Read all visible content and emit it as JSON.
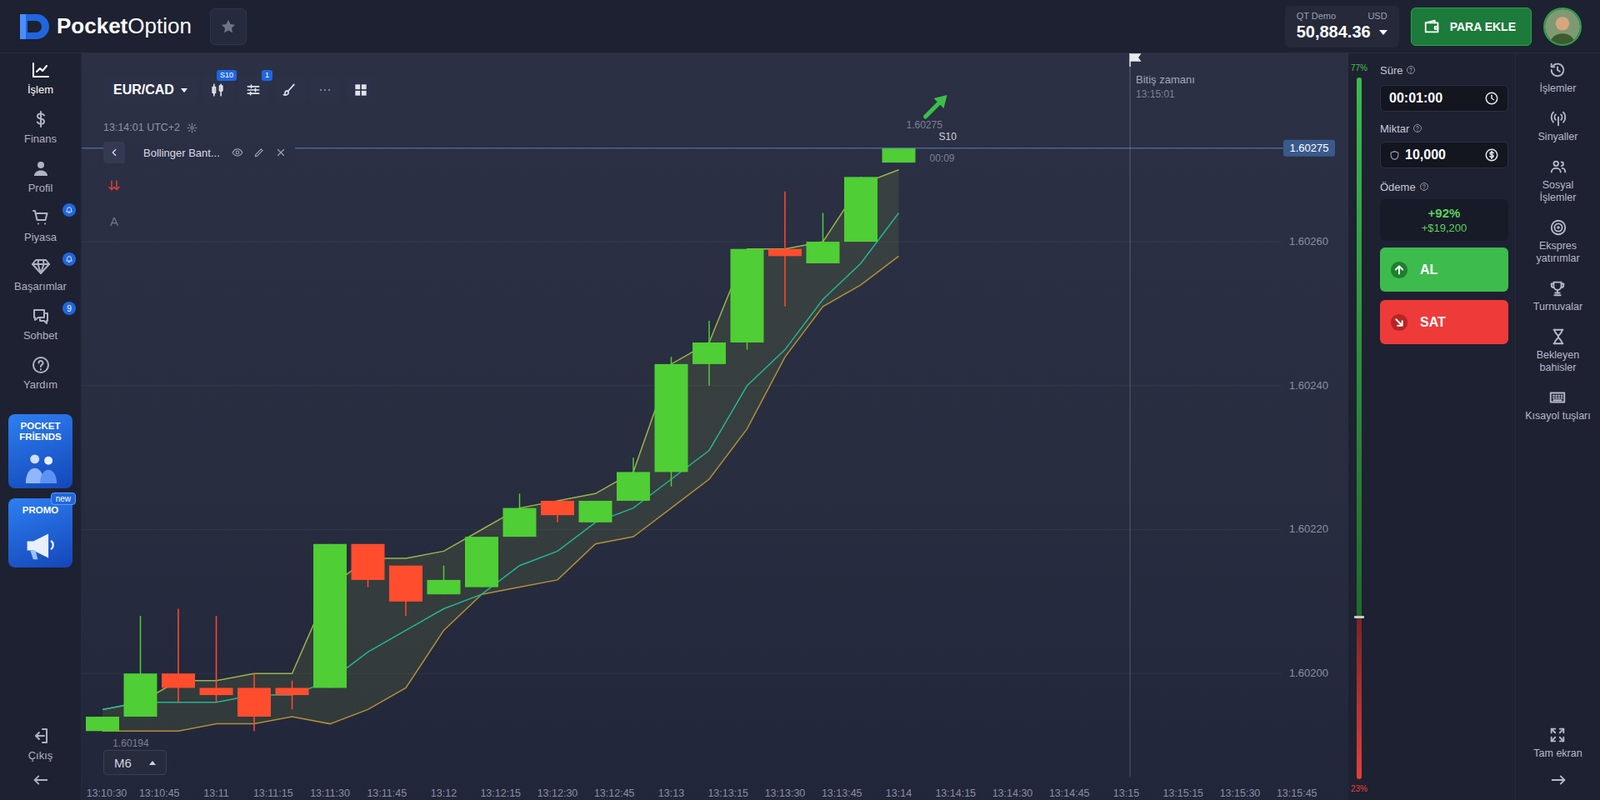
{
  "topbar": {
    "logo": {
      "bold": "Pocket",
      "light": "Option"
    },
    "account": {
      "mode": "QT Demo",
      "currency": "USD",
      "balance": "50,884.36"
    },
    "deposit_button": "PARA EKLE"
  },
  "sidebar": {
    "items": [
      {
        "label": "İşlem",
        "selected": true,
        "kind": "plain"
      },
      {
        "label": "Finans",
        "selected": false,
        "kind": "plain"
      },
      {
        "label": "Profil",
        "selected": false,
        "kind": "plain"
      },
      {
        "label": "Piyasa",
        "selected": false,
        "kind": "bell"
      },
      {
        "label": "Başarımlar",
        "selected": false,
        "kind": "bell"
      },
      {
        "label": "Sohbet",
        "selected": false,
        "kind": "count",
        "badge": "9"
      },
      {
        "label": "Yardım",
        "selected": false,
        "kind": "plain"
      }
    ],
    "promos": [
      {
        "title": "POCKET FRİENDS",
        "kind": "friends"
      },
      {
        "title": "PROMO",
        "kind": "promo",
        "badge": "new"
      }
    ],
    "logout": "Çıkış"
  },
  "chart": {
    "pair": "EUR/CAD",
    "chart_type_badge": "S10",
    "settings_badge": "1",
    "clock": "13:14:01 UTC+2",
    "indicator": "Bollinger Bant...",
    "text_tool": "A",
    "timeframe": "M6",
    "price_ticks": [
      "1.60260",
      "1.60240",
      "1.60220",
      "1.60200"
    ],
    "time_ticks": [
      "13:10:30",
      "13:10:45",
      "13:11",
      "13:11:15",
      "13:11:30",
      "13:11:45",
      "13:12",
      "13:12:15",
      "13:12:30",
      "13:12:45",
      "13:13",
      "13:13:15",
      "13:13:30",
      "13:13:45",
      "13:14",
      "13:14:15",
      "13:14:30",
      "13:14:45",
      "13:15",
      "13:15:15",
      "13:15:30",
      "13:15:45"
    ],
    "current_price": "1.60275",
    "candle_price_label": "1.60275",
    "candle_timer": {
      "period": "S10",
      "remaining": "00:09"
    },
    "low_label": "1.60194",
    "expiry": {
      "label": "Bitiş zamanı",
      "time": "13:15:01"
    },
    "candles": [
      {
        "open": 1.60192,
        "high": 1.60194,
        "low": 1.60192,
        "close": 1.60194
      },
      {
        "open": 1.60194,
        "high": 1.60208,
        "low": 1.60194,
        "close": 1.602
      },
      {
        "open": 1.602,
        "high": 1.60209,
        "low": 1.60196,
        "close": 1.60198
      },
      {
        "open": 1.60198,
        "high": 1.60208,
        "low": 1.60196,
        "close": 1.60197
      },
      {
        "open": 1.60198,
        "high": 1.602,
        "low": 1.60192,
        "close": 1.60194
      },
      {
        "open": 1.60198,
        "high": 1.60199,
        "low": 1.60195,
        "close": 1.60197
      },
      {
        "open": 1.60198,
        "high": 1.60218,
        "low": 1.60198,
        "close": 1.60218
      },
      {
        "open": 1.60218,
        "high": 1.60218,
        "low": 1.60212,
        "close": 1.60213
      },
      {
        "open": 1.60215,
        "high": 1.60215,
        "low": 1.60208,
        "close": 1.6021
      },
      {
        "open": 1.60211,
        "high": 1.60215,
        "low": 1.60211,
        "close": 1.60213
      },
      {
        "open": 1.60212,
        "high": 1.60219,
        "low": 1.60212,
        "close": 1.60219
      },
      {
        "open": 1.60219,
        "high": 1.60225,
        "low": 1.60219,
        "close": 1.60223
      },
      {
        "open": 1.60224,
        "high": 1.60224,
        "low": 1.60221,
        "close": 1.60222
      },
      {
        "open": 1.60221,
        "high": 1.60224,
        "low": 1.60221,
        "close": 1.60224
      },
      {
        "open": 1.60224,
        "high": 1.6023,
        "low": 1.60224,
        "close": 1.60228
      },
      {
        "open": 1.60228,
        "high": 1.60244,
        "low": 1.60226,
        "close": 1.60243
      },
      {
        "open": 1.60243,
        "high": 1.60249,
        "low": 1.6024,
        "close": 1.60246
      },
      {
        "open": 1.60246,
        "high": 1.60259,
        "low": 1.60245,
        "close": 1.60259
      },
      {
        "open": 1.60259,
        "high": 1.60267,
        "low": 1.60251,
        "close": 1.60258
      },
      {
        "open": 1.60257,
        "high": 1.60264,
        "low": 1.60257,
        "close": 1.6026
      },
      {
        "open": 1.6026,
        "high": 1.60269,
        "low": 1.6026,
        "close": 1.60269
      },
      {
        "open": 1.60271,
        "high": 1.60273,
        "low": 1.60271,
        "close": 1.60273
      }
    ],
    "bollinger": {
      "upper": [
        1.60195,
        1.60196,
        1.60199,
        1.60199,
        1.602,
        1.602,
        1.60212,
        1.60216,
        1.60216,
        1.60217,
        1.6022,
        1.60223,
        1.60224,
        1.60225,
        1.60228,
        1.60243,
        1.60246,
        1.60259,
        1.60259,
        1.6026,
        1.60268,
        1.6027
      ],
      "middle": [
        1.60195,
        1.60196,
        1.60196,
        1.60196,
        1.60197,
        1.60197,
        1.60199,
        1.60203,
        1.60206,
        1.60209,
        1.60211,
        1.60215,
        1.60217,
        1.60221,
        1.60223,
        1.60227,
        1.60231,
        1.6024,
        1.60245,
        1.60252,
        1.60257,
        1.60264
      ],
      "lower": [
        1.60192,
        1.60192,
        1.60192,
        1.60193,
        1.60193,
        1.60194,
        1.60193,
        1.60195,
        1.60198,
        1.60206,
        1.60211,
        1.60212,
        1.60213,
        1.60218,
        1.60219,
        1.60223,
        1.60227,
        1.60234,
        1.60244,
        1.60251,
        1.60254,
        1.60258
      ]
    }
  },
  "sentiment": {
    "up": "77%",
    "down": "23%",
    "level": 0.77
  },
  "trade": {
    "duration": {
      "label": "Süre",
      "value": "00:01:00"
    },
    "amount": {
      "label": "Miktar",
      "value": "10,000"
    },
    "payout": {
      "label": "Ödeme",
      "percent": "+92%",
      "profit": "+$19,200"
    },
    "buy": "AL",
    "sell": "SAT"
  },
  "right_sidebar": {
    "items": [
      "İşlemler",
      "Sinyaller",
      "Sosyal İşlemler",
      "Ekspres yatırımlar",
      "Turnuvalar",
      "Bekleyen bahisler",
      "Kısayol tuşları"
    ],
    "fullscreen": "Tam ekran"
  }
}
